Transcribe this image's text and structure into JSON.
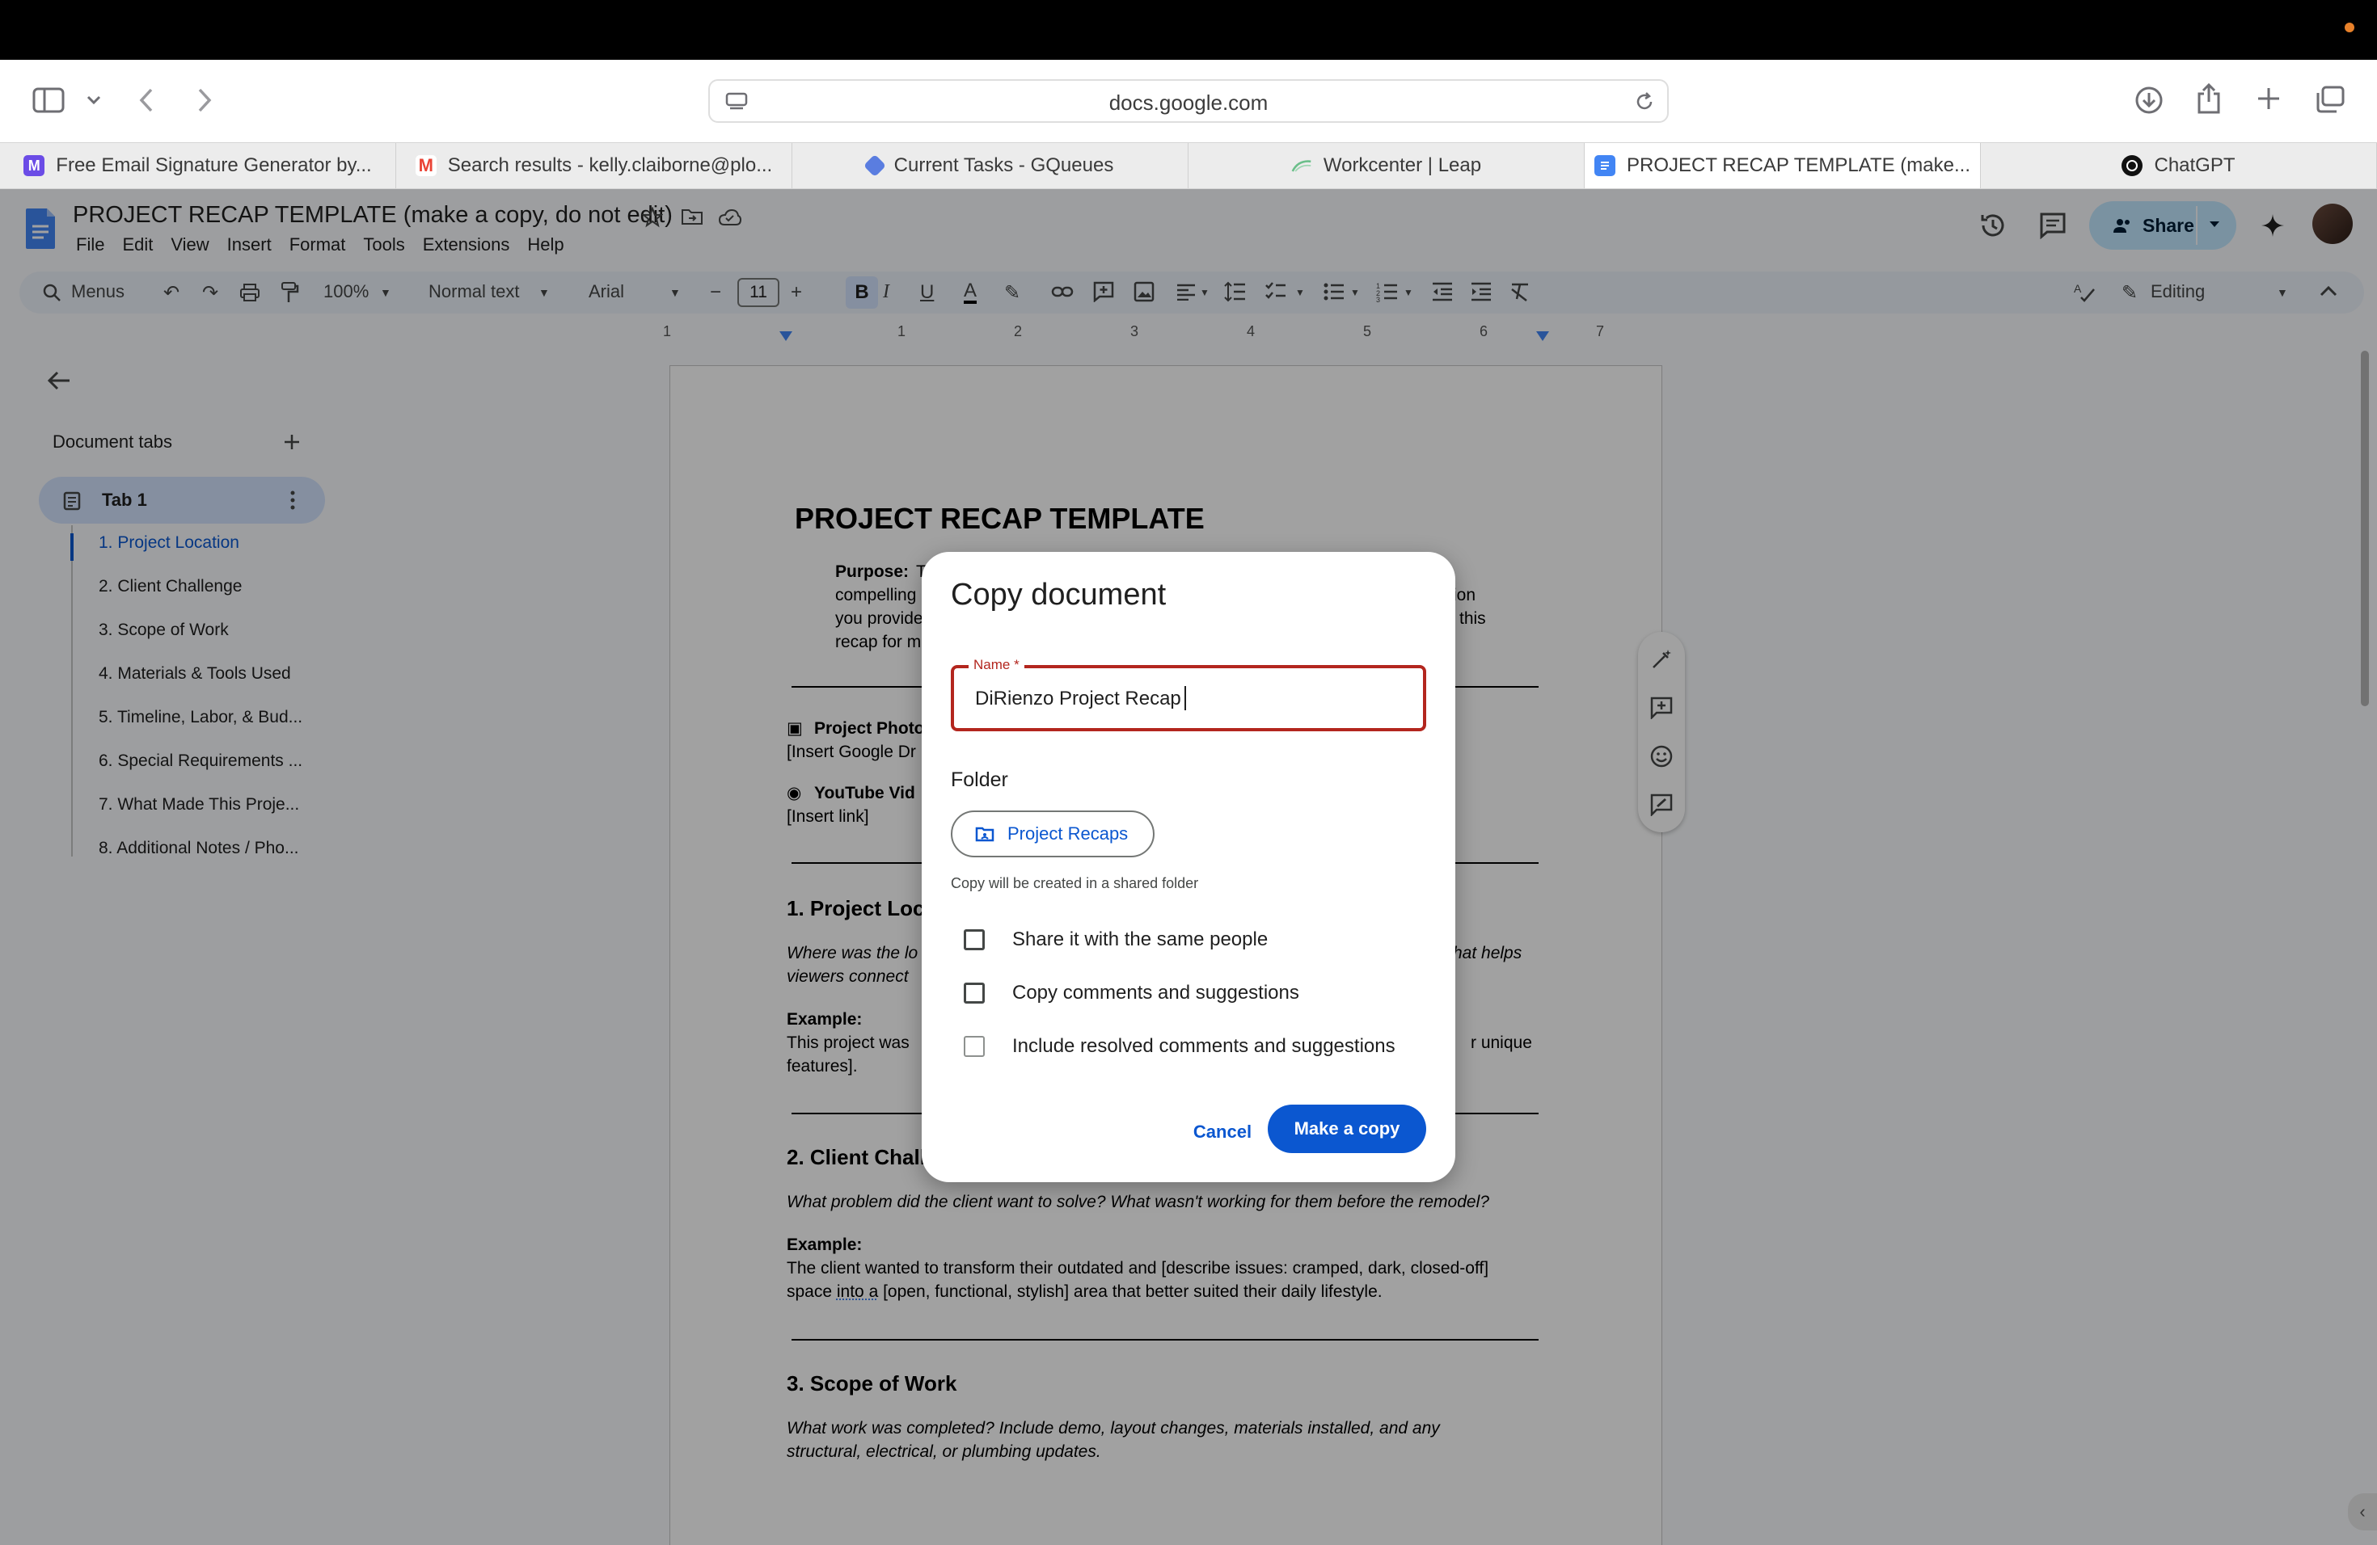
{
  "browser": {
    "url": "docs.google.com",
    "tabs": [
      {
        "title": "Free Email Signature Generator by...",
        "icon": "signature-favicon",
        "color": "#6b4ce6"
      },
      {
        "title": "Search results - kelly.claiborne@plo...",
        "icon": "gmail-favicon",
        "color": "#ea4335"
      },
      {
        "title": "Current Tasks - GQueues",
        "icon": "gqueues-favicon",
        "color": "#5a7de0"
      },
      {
        "title": "Workcenter | Leap",
        "icon": "leap-favicon",
        "color": "#6bbf8a"
      },
      {
        "title": "PROJECT RECAP TEMPLATE (make...",
        "icon": "docs-favicon",
        "color": "#4285f4"
      },
      {
        "title": "ChatGPT",
        "icon": "chatgpt-favicon",
        "color": "#111111"
      }
    ]
  },
  "docs": {
    "title": "PROJECT RECAP TEMPLATE (make a copy, do not edit)",
    "menus": [
      "File",
      "Edit",
      "View",
      "Insert",
      "Format",
      "Tools",
      "Extensions",
      "Help"
    ],
    "share_label": "Share",
    "toolbar": {
      "search_label": "Menus",
      "zoom": "100%",
      "style": "Normal text",
      "font": "Arial",
      "font_size": "11",
      "mode": "Editing"
    },
    "ruler": [
      "1",
      "1",
      "2",
      "3",
      "4",
      "5",
      "6",
      "7"
    ]
  },
  "sidebar": {
    "title": "Document tabs",
    "tab_label": "Tab 1",
    "outline": [
      "1. Project Location",
      "2. Client Challenge",
      "3. Scope of Work",
      "4. Materials & Tools Used",
      "5. Timeline, Labor, & Bud...",
      "6. Special Requirements ...",
      "7. What Made This Proje...",
      "8. Additional Notes / Pho..."
    ]
  },
  "document": {
    "heading": "PROJECT RECAP TEMPLATE",
    "purpose_label": "Purpose:",
    "purpose_lines": [
      "T",
      "compelling",
      "you provide",
      "recap for m"
    ],
    "purpose_right": [
      "ion",
      "this"
    ],
    "photos_label": "Project Photo",
    "photos_text": "[Insert Google Dr",
    "video_label": "YouTube Vid",
    "video_text": "[Insert link]",
    "s1_title": "1. Project Loc",
    "s1_q1": "Where was the lo",
    "s1_q2": "viewers connect",
    "s1_q_right": "hat helps",
    "s1_example": "Example:",
    "s1_ex1": "This project was",
    "s1_ex_right": "r unique",
    "s1_ex2": "features].",
    "s2_title": "2. Client Chall",
    "s2_q": "What problem did the client want to solve? What wasn't working for them before the remodel?",
    "s2_example": "Example:",
    "s2_ex1": "The client wanted to transform their outdated and [describe issues: cramped, dark, closed-off]",
    "s2_ex2a": "space ",
    "s2_ex2b": "into a",
    "s2_ex2c": " [open, functional, stylish] area that better suited their daily lifestyle.",
    "s3_title": "3. Scope of Work",
    "s3_q1": "What work was completed? Include demo, layout changes, materials installed, and any",
    "s3_q2": "structural, electrical, or plumbing updates."
  },
  "dialog": {
    "title": "Copy document",
    "name_label": "Name *",
    "name_value": "DiRienzo Project Recap",
    "folder_label": "Folder",
    "folder_chip": "Project Recaps",
    "folder_note": "Copy will be created in a shared folder",
    "options": [
      {
        "label": "Share it with the same people",
        "checked": false
      },
      {
        "label": "Copy comments and suggestions",
        "checked": false
      },
      {
        "label": "Include resolved comments and suggestions",
        "checked": false
      }
    ],
    "cancel_label": "Cancel",
    "confirm_label": "Make a copy"
  },
  "colors": {
    "accent": "#0b57d0",
    "error": "#b3261e",
    "share_bg": "#c2e7ff"
  }
}
